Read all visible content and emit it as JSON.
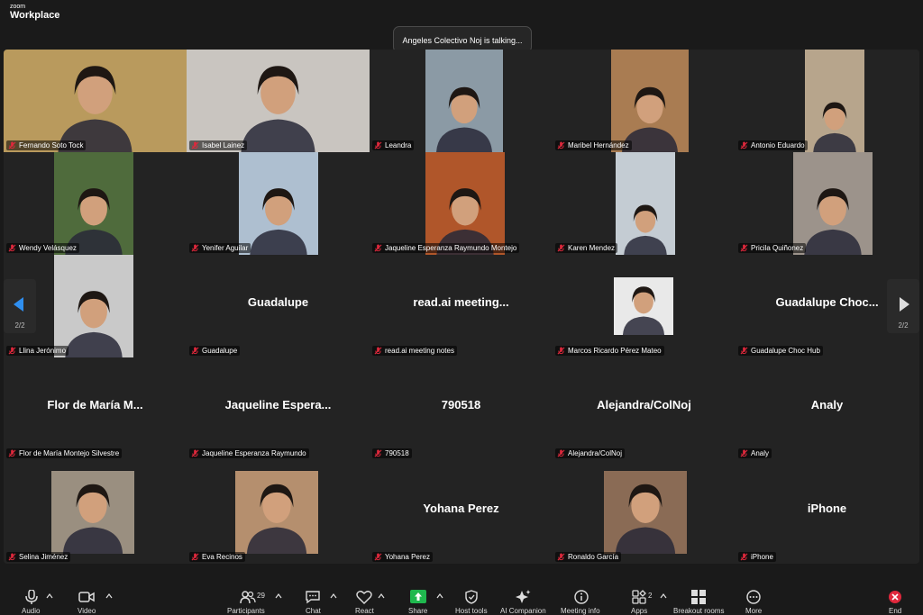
{
  "app": {
    "brand_top": "zoom",
    "brand_bottom": "Workplace"
  },
  "banner": {
    "text": "Angeles  Colectivo Noj is talking..."
  },
  "tiles": [
    {
      "label": "Fernando Soto Tock",
      "kind": "video",
      "bg": "#b99a5d"
    },
    {
      "label": "Isabel Lainez",
      "kind": "video",
      "bg": "#c9c5c0"
    },
    {
      "label": "Leandra",
      "kind": "video",
      "bg": "#8b9aa5"
    },
    {
      "label": "Maribel Hernández",
      "kind": "video",
      "bg": "#a97c52"
    },
    {
      "label": "Antonio Eduardo",
      "kind": "video",
      "bg": "#b7a58c"
    },
    {
      "label": "Wendy Velásquez",
      "kind": "video",
      "bg": "#4f6b3c"
    },
    {
      "label": "Yenifer Aguilar",
      "kind": "video",
      "bg": "#aebfd0"
    },
    {
      "label": "Jaqueline Esperanza Raymundo Montejo",
      "kind": "video",
      "bg": "#b0562a"
    },
    {
      "label": "Karen Mendez",
      "kind": "video",
      "bg": "#c4ccd3"
    },
    {
      "label": "Pricila Quiñonez",
      "kind": "video",
      "bg": "#9c938b"
    },
    {
      "label": "Llina Jerónimo",
      "kind": "video",
      "bg": "#c9c9c9"
    },
    {
      "label": "Guadalupe",
      "kind": "name",
      "big": "Guadalupe"
    },
    {
      "label": "read.ai meeting notes",
      "kind": "name",
      "big": "read.ai  meeting..."
    },
    {
      "label": "Marcos Ricardo Pérez Mateo",
      "kind": "photo",
      "bg": "#e9e9e9"
    },
    {
      "label": "Guadalupe Choc Hub",
      "kind": "name",
      "big": "Guadalupe  Choc..."
    },
    {
      "label": "Flor de María Montejo Silvestre",
      "kind": "name",
      "big": "Flor de María M..."
    },
    {
      "label": "Jaqueline Esperanza Raymundo",
      "kind": "name",
      "big": "Jaqueline  Espera..."
    },
    {
      "label": "790518",
      "kind": "name",
      "big": "790518"
    },
    {
      "label": "Alejandra/ColNoj",
      "kind": "name",
      "big": "Alejandra/ColNoj"
    },
    {
      "label": "Analy",
      "kind": "name",
      "big": "Analy"
    },
    {
      "label": "Selina Jiménez",
      "kind": "photo",
      "bg": "#9a8f80"
    },
    {
      "label": "Eva Recinos",
      "kind": "photo",
      "bg": "#b58f6e"
    },
    {
      "label": "Yohana Perez",
      "kind": "name",
      "big": "Yohana Perez"
    },
    {
      "label": "Ronaldo García",
      "kind": "photo",
      "bg": "#8a6b55"
    },
    {
      "label": "iPhone",
      "kind": "name",
      "big": "iPhone"
    }
  ],
  "pager": {
    "left": "2/2",
    "right": "2/2"
  },
  "toolbar": {
    "audio": "Audio",
    "video": "Video",
    "participants": "Participants",
    "participants_count": "29",
    "chat": "Chat",
    "react": "React",
    "share": "Share",
    "host_tools": "Host tools",
    "ai_companion": "AI Companion",
    "meeting_info": "Meeting info",
    "apps": "Apps",
    "apps_count": "2",
    "breakout": "Breakout rooms",
    "more": "More",
    "end": "End"
  },
  "colors": {
    "share": "#1fb84e",
    "end": "#e0283c",
    "nav_active": "#2f8ff0",
    "mute": "#e0283c"
  }
}
